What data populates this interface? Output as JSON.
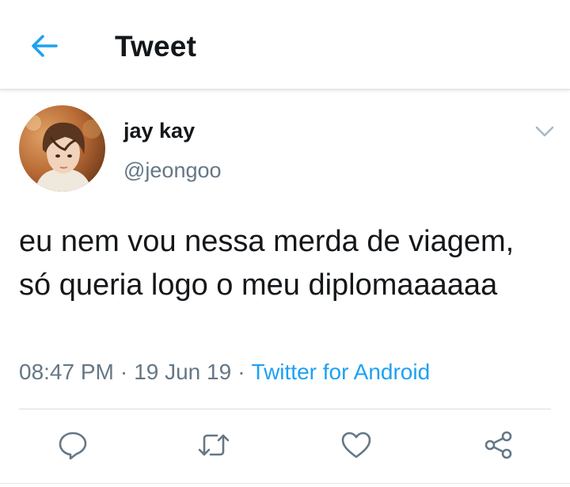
{
  "header": {
    "title": "Tweet",
    "back_icon": "arrow-left-icon"
  },
  "colors": {
    "accent": "#1da1f2",
    "text_primary": "#14171a",
    "text_secondary": "#657786",
    "divider": "#e1e8ed"
  },
  "tweet": {
    "author": {
      "display_name": "jay kay",
      "handle": "@jeongoo",
      "avatar_icon": "user-avatar"
    },
    "text": "eu nem vou nessa merda de viagem, só queria logo o meu diplomaaaaaa",
    "time": "08:47 PM",
    "date": "19 Jun 19",
    "separator": "·",
    "source": "Twitter for Android",
    "menu_icon": "chevron-down-icon"
  },
  "actions": [
    {
      "name": "reply",
      "icon": "reply-icon"
    },
    {
      "name": "retweet",
      "icon": "retweet-icon"
    },
    {
      "name": "like",
      "icon": "heart-icon"
    },
    {
      "name": "share",
      "icon": "share-icon"
    }
  ]
}
